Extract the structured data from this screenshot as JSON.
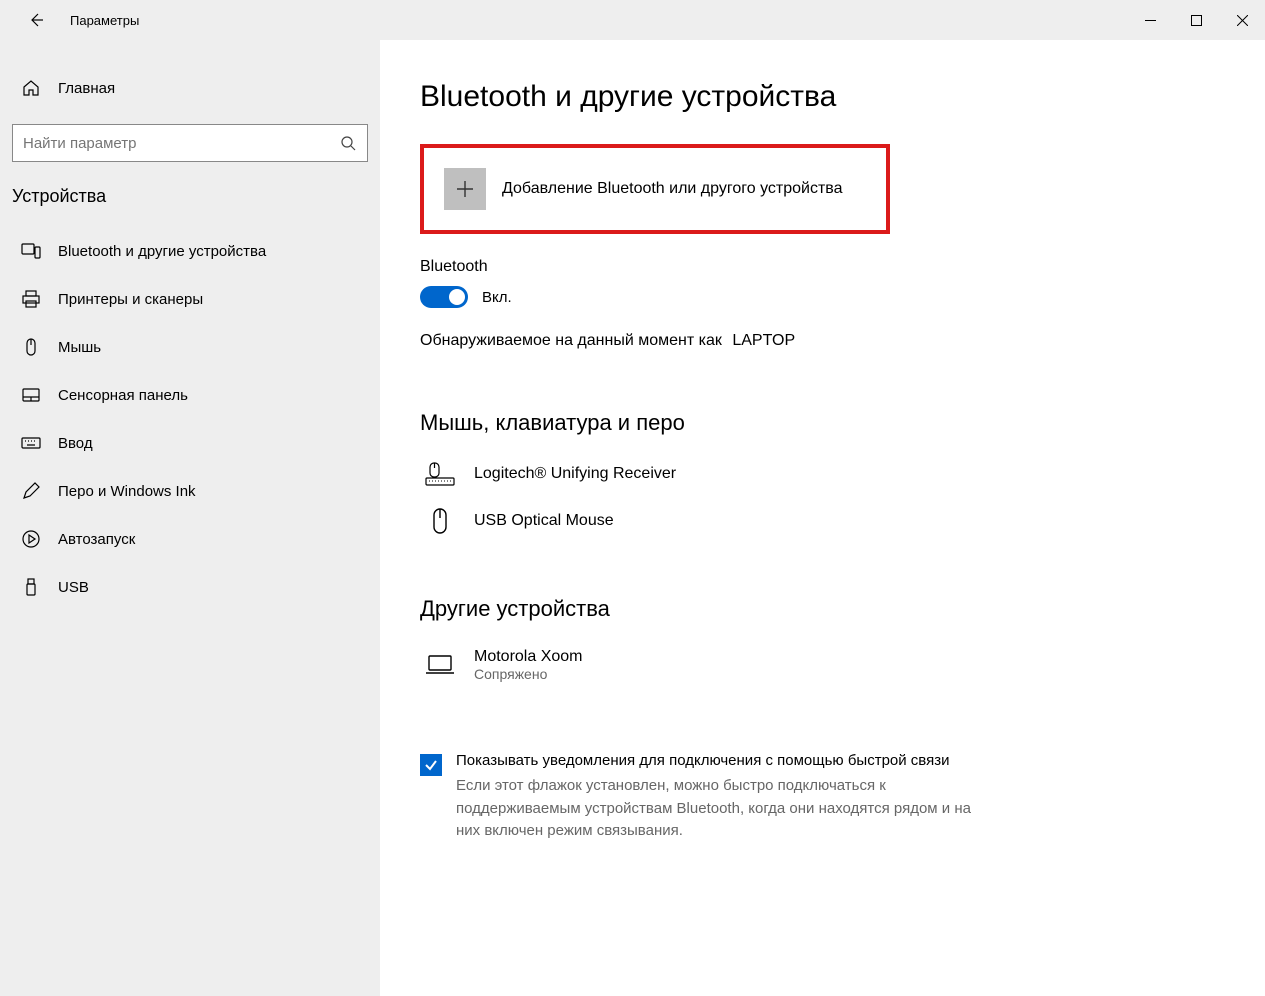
{
  "window": {
    "title": "Параметры"
  },
  "sidebar": {
    "home_label": "Главная",
    "search_placeholder": "Найти параметр",
    "category": "Устройства",
    "items": [
      {
        "label": "Bluetooth и другие устройства"
      },
      {
        "label": "Принтеры и сканеры"
      },
      {
        "label": "Мышь"
      },
      {
        "label": "Сенсорная панель"
      },
      {
        "label": "Ввод"
      },
      {
        "label": "Перо и Windows Ink"
      },
      {
        "label": "Автозапуск"
      },
      {
        "label": "USB"
      }
    ]
  },
  "main": {
    "page_title": "Bluetooth и другие устройства",
    "add_device_label": "Добавление Bluetooth или другого устройства",
    "bluetooth_label": "Bluetooth",
    "toggle_state": "Вкл.",
    "discoverable_prefix": "Обнаруживаемое на данный момент как",
    "discoverable_name": "LAPTOP",
    "section_input": "Мышь, клавиатура и перо",
    "input_devices": [
      {
        "name": "Logitech® Unifying Receiver"
      },
      {
        "name": "USB Optical Mouse"
      }
    ],
    "section_other": "Другие устройства",
    "other_devices": [
      {
        "name": "Motorola Xoom",
        "status": "Сопряжено"
      }
    ],
    "quick_pair_label": "Показывать уведомления для подключения с помощью быстрой связи",
    "quick_pair_desc": "Если этот флажок установлен, можно быстро подключаться к поддерживаемым устройствам Bluetooth, когда они находятся рядом и на них включен режим связывания."
  }
}
